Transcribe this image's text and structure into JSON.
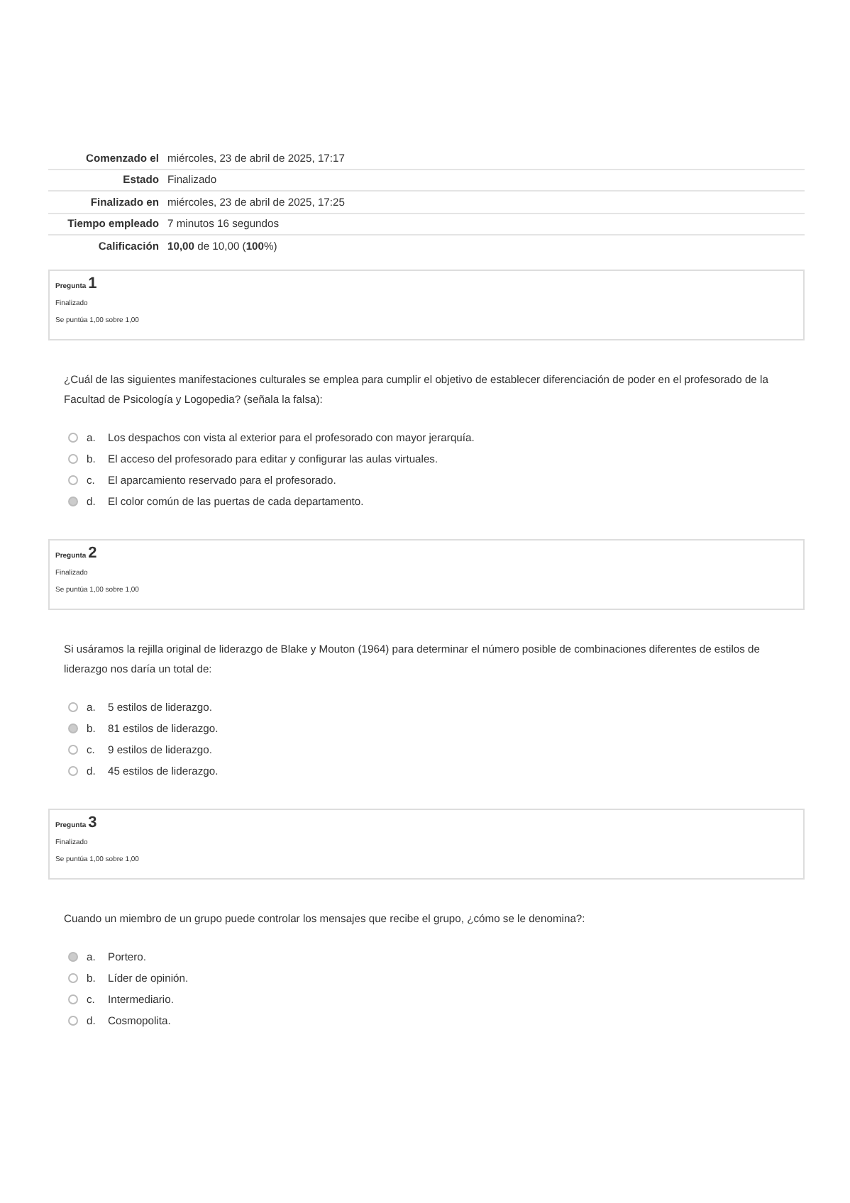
{
  "summary": [
    {
      "label": "Comenzado el",
      "value": "miércoles, 23 de abril de 2025, 17:17"
    },
    {
      "label": "Estado",
      "value": "Finalizado"
    },
    {
      "label": "Finalizado en",
      "value": "miércoles, 23 de abril de 2025, 17:25"
    },
    {
      "label": "Tiempo empleado",
      "value": "7 minutos 16 segundos"
    },
    {
      "label": "Calificación",
      "value": "**10,00** de 10,00 (**100**%)"
    }
  ],
  "questions": [
    {
      "label": "Pregunta",
      "number": "1",
      "state": "Finalizado",
      "grade": "Se puntúa 1,00 sobre 1,00",
      "text": "¿Cuál de las siguientes manifestaciones culturales se emplea para cumplir el objetivo de establecer diferenciación de poder en el profesorado de la Facultad de Psicología y Logopedia? (señala la falsa):",
      "options": [
        {
          "letter": "a.",
          "text": "Los despachos con vista al exterior para el profesorado con mayor jerarquía.",
          "selected": false
        },
        {
          "letter": "b.",
          "text": "El acceso del profesorado para editar y configurar las aulas virtuales.",
          "selected": false
        },
        {
          "letter": "c.",
          "text": "El aparcamiento reservado para el profesorado.",
          "selected": false
        },
        {
          "letter": "d.",
          "text": "El color común de las puertas de cada departamento.",
          "selected": true
        }
      ]
    },
    {
      "label": "Pregunta",
      "number": "2",
      "state": "Finalizado",
      "grade": "Se puntúa 1,00 sobre 1,00",
      "text": "Si usáramos la rejilla original de liderazgo de Blake y Mouton (1964) para determinar el número posible de combinaciones diferentes de estilos de liderazgo nos daría un total de:",
      "options": [
        {
          "letter": "a.",
          "text": "5 estilos de liderazgo.",
          "selected": false
        },
        {
          "letter": "b.",
          "text": "81 estilos de liderazgo.",
          "selected": true
        },
        {
          "letter": "c.",
          "text": "9 estilos de liderazgo.",
          "selected": false
        },
        {
          "letter": "d.",
          "text": "45 estilos de liderazgo.",
          "selected": false
        }
      ]
    },
    {
      "label": "Pregunta",
      "number": "3",
      "state": "Finalizado",
      "grade": "Se puntúa 1,00 sobre 1,00",
      "text": "Cuando un miembro de un grupo puede controlar los mensajes que recibe el grupo, ¿cómo se le denomina?:",
      "options": [
        {
          "letter": "a.",
          "text": "Portero.",
          "selected": true
        },
        {
          "letter": "b.",
          "text": "Líder de opinión.",
          "selected": false
        },
        {
          "letter": "c.",
          "text": "Intermediario.",
          "selected": false
        },
        {
          "letter": "d.",
          "text": "Cosmopolita.",
          "selected": false
        }
      ]
    }
  ]
}
